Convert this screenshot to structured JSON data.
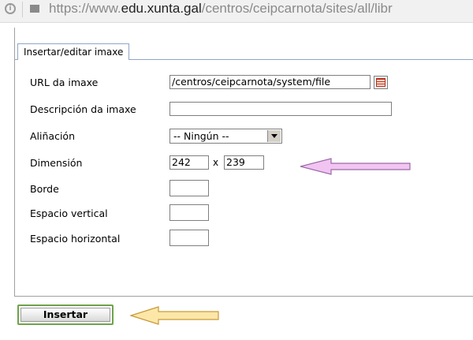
{
  "browser": {
    "url_prefix": "https://www.",
    "url_domain": "edu.xunta.gal",
    "url_path": "/centros/ceipcarnota/sites/all/libr"
  },
  "dialog": {
    "tab_label": "Insertar/editar imaxe",
    "fields": {
      "url_label": "URL da imaxe",
      "url_value": "/centros/ceipcarnota/system/file",
      "description_label": "Descripción da imaxe",
      "description_value": "",
      "alignment_label": "Aliñación",
      "alignment_value": "-- Ningún --",
      "dimension_label": "Dimensión",
      "width_value": "242",
      "height_value": "239",
      "dimension_separator": "x",
      "border_label": "Borde",
      "border_value": "",
      "vspace_label": "Espacio vertical",
      "vspace_value": "",
      "hspace_label": "Espacio horizontal",
      "hspace_value": ""
    },
    "insert_label": "Insertar"
  },
  "annotations": {
    "pink_arrow_color": "#f2c4f2",
    "yellow_arrow_color": "#fde7a8"
  }
}
